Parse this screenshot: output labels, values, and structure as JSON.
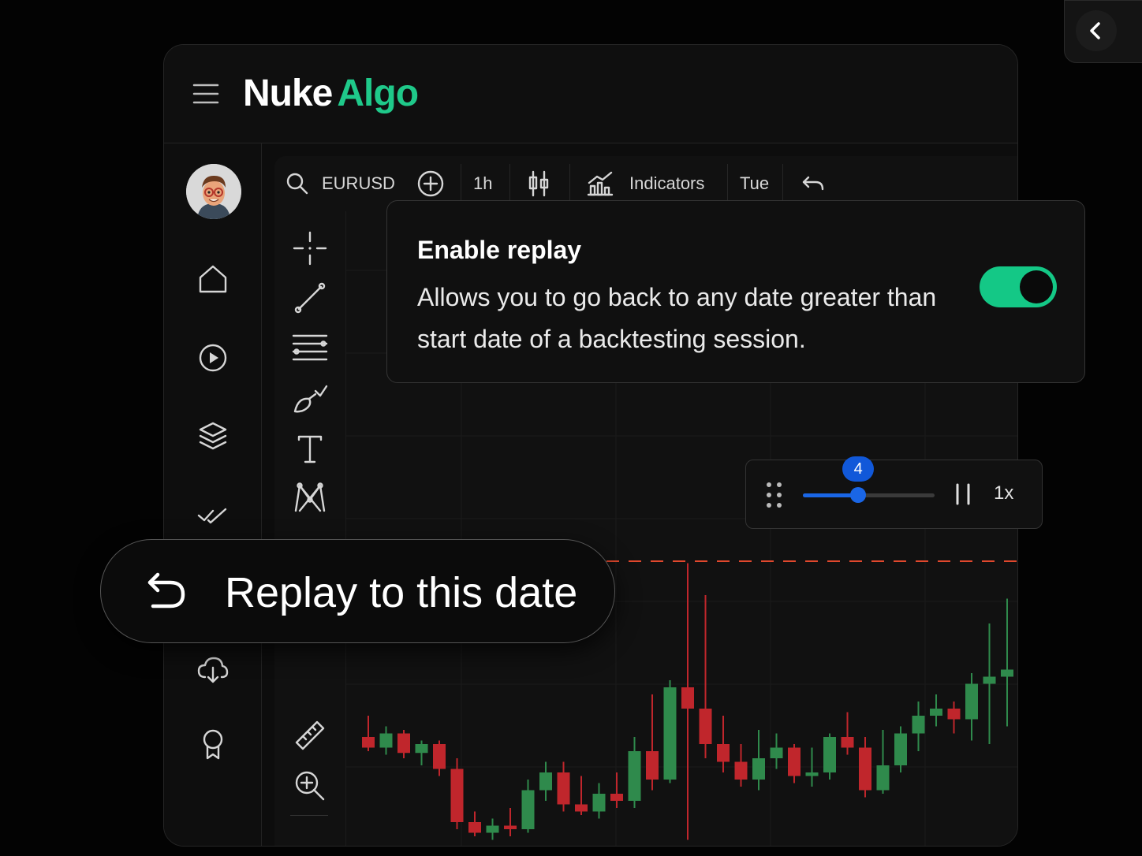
{
  "app": {
    "brand_part1": "Nuke",
    "brand_part2": "Algo",
    "brand_accent": "#1fc98a"
  },
  "sidebar": {
    "items": [
      {
        "icon": "home-icon"
      },
      {
        "icon": "play-icon"
      },
      {
        "icon": "layers-icon"
      },
      {
        "icon": "double-check-icon"
      },
      {
        "icon": "cloud-download-icon"
      },
      {
        "icon": "award-icon"
      }
    ]
  },
  "toolbar": {
    "symbol": "EURUSD",
    "interval": "1h",
    "indicators_label": "Indicators",
    "day_label": "Tue"
  },
  "drawing_tools": [
    "crosshair-icon",
    "trend-line-icon",
    "horizontal-lines-icon",
    "brush-icon",
    "text-icon",
    "pattern-icon",
    "ruler-icon",
    "zoom-in-icon",
    "magnet-icon"
  ],
  "replay_popup": {
    "title": "Enable replay",
    "description": "Allows you to go back to any date greater than start date of a backtesting session.",
    "enabled": true,
    "toggle_color": "#14c886"
  },
  "speed_control": {
    "value": "4",
    "level_fraction": 0.42,
    "speed_label": "1x",
    "accent": "#1a66e6"
  },
  "replay_pill": {
    "label": "Replay to this date"
  },
  "chart_data": {
    "type": "candlestick",
    "up_color": "#2f8a4c",
    "down_color": "#c0262c",
    "marker_line_color": "#e0482d",
    "candles": [
      {
        "o": 60,
        "h": 72,
        "l": 52,
        "c": 54
      },
      {
        "o": 54,
        "h": 66,
        "l": 50,
        "c": 62
      },
      {
        "o": 62,
        "h": 64,
        "l": 48,
        "c": 51
      },
      {
        "o": 51,
        "h": 58,
        "l": 44,
        "c": 56
      },
      {
        "o": 56,
        "h": 58,
        "l": 38,
        "c": 42
      },
      {
        "o": 42,
        "h": 48,
        "l": 8,
        "c": 12
      },
      {
        "o": 12,
        "h": 18,
        "l": 4,
        "c": 6
      },
      {
        "o": 6,
        "h": 14,
        "l": 2,
        "c": 10
      },
      {
        "o": 10,
        "h": 20,
        "l": 4,
        "c": 8
      },
      {
        "o": 8,
        "h": 36,
        "l": 6,
        "c": 30
      },
      {
        "o": 30,
        "h": 46,
        "l": 24,
        "c": 40
      },
      {
        "o": 40,
        "h": 46,
        "l": 18,
        "c": 22
      },
      {
        "o": 22,
        "h": 38,
        "l": 16,
        "c": 18
      },
      {
        "o": 18,
        "h": 34,
        "l": 14,
        "c": 28
      },
      {
        "o": 28,
        "h": 40,
        "l": 20,
        "c": 24
      },
      {
        "o": 24,
        "h": 60,
        "l": 20,
        "c": 52
      },
      {
        "o": 52,
        "h": 84,
        "l": 30,
        "c": 36
      },
      {
        "o": 36,
        "h": 92,
        "l": 34,
        "c": 88
      },
      {
        "o": 88,
        "h": 158,
        "l": 2,
        "c": 76
      },
      {
        "o": 76,
        "h": 140,
        "l": 48,
        "c": 56
      },
      {
        "o": 56,
        "h": 72,
        "l": 40,
        "c": 46
      },
      {
        "o": 46,
        "h": 56,
        "l": 32,
        "c": 36
      },
      {
        "o": 36,
        "h": 64,
        "l": 30,
        "c": 48
      },
      {
        "o": 48,
        "h": 62,
        "l": 42,
        "c": 54
      },
      {
        "o": 54,
        "h": 56,
        "l": 34,
        "c": 38
      },
      {
        "o": 38,
        "h": 54,
        "l": 32,
        "c": 40
      },
      {
        "o": 40,
        "h": 62,
        "l": 36,
        "c": 60
      },
      {
        "o": 60,
        "h": 74,
        "l": 50,
        "c": 54
      },
      {
        "o": 54,
        "h": 60,
        "l": 26,
        "c": 30
      },
      {
        "o": 30,
        "h": 64,
        "l": 28,
        "c": 44
      },
      {
        "o": 44,
        "h": 66,
        "l": 40,
        "c": 62
      },
      {
        "o": 62,
        "h": 80,
        "l": 52,
        "c": 72
      },
      {
        "o": 72,
        "h": 84,
        "l": 66,
        "c": 76
      },
      {
        "o": 76,
        "h": 80,
        "l": 62,
        "c": 70
      },
      {
        "o": 70,
        "h": 96,
        "l": 58,
        "c": 90
      },
      {
        "o": 90,
        "h": 124,
        "l": 56,
        "c": 94
      },
      {
        "o": 94,
        "h": 138,
        "l": 66,
        "c": 98
      }
    ]
  }
}
